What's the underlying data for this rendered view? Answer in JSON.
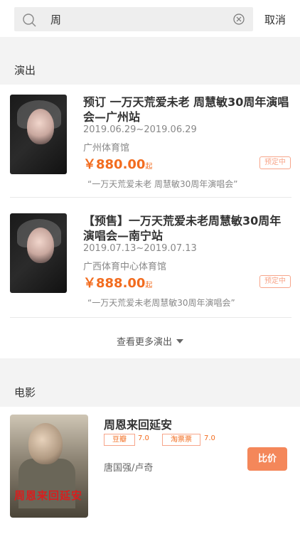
{
  "search": {
    "query": "周",
    "cancel_label": "取消"
  },
  "sections": {
    "shows_label": "演出",
    "movies_label": "电影"
  },
  "shows": [
    {
      "title": "预订 一万天荒爱未老 周慧敏30周年演唱会—广州站",
      "date": "2019.06.29~2019.06.29",
      "venue": "广州体育馆",
      "price": "￥880.00",
      "price_unit": "起",
      "badge": "预定中",
      "desc": "“一万天荒爱未老 周慧敏30周年演唱会”"
    },
    {
      "title": "【预售】一万天荒爱未老周慧敏30周年演唱会—南宁站",
      "date": "2019.07.13~2019.07.13",
      "venue": "广西体育中心体育馆",
      "price": "￥888.00",
      "price_unit": "起",
      "badge": "预定中",
      "desc": "“一万天荒爱未老周慧敏30周年演唱会”"
    }
  ],
  "more_shows_label": "查看更多演出",
  "movie": {
    "title": "周恩来回延安",
    "douban_label": "豆瓣",
    "douban_score": "7.0",
    "taopiaopiao_label": "淘票票",
    "taopiaopiao_score": "7.0",
    "cast": "唐国强/卢奇",
    "compare_label": "比价",
    "poster_text": "周恩来回延安"
  },
  "colors": {
    "accent": "#f26c1f",
    "button": "#f4875a",
    "section_bg": "#f3f3f3"
  }
}
